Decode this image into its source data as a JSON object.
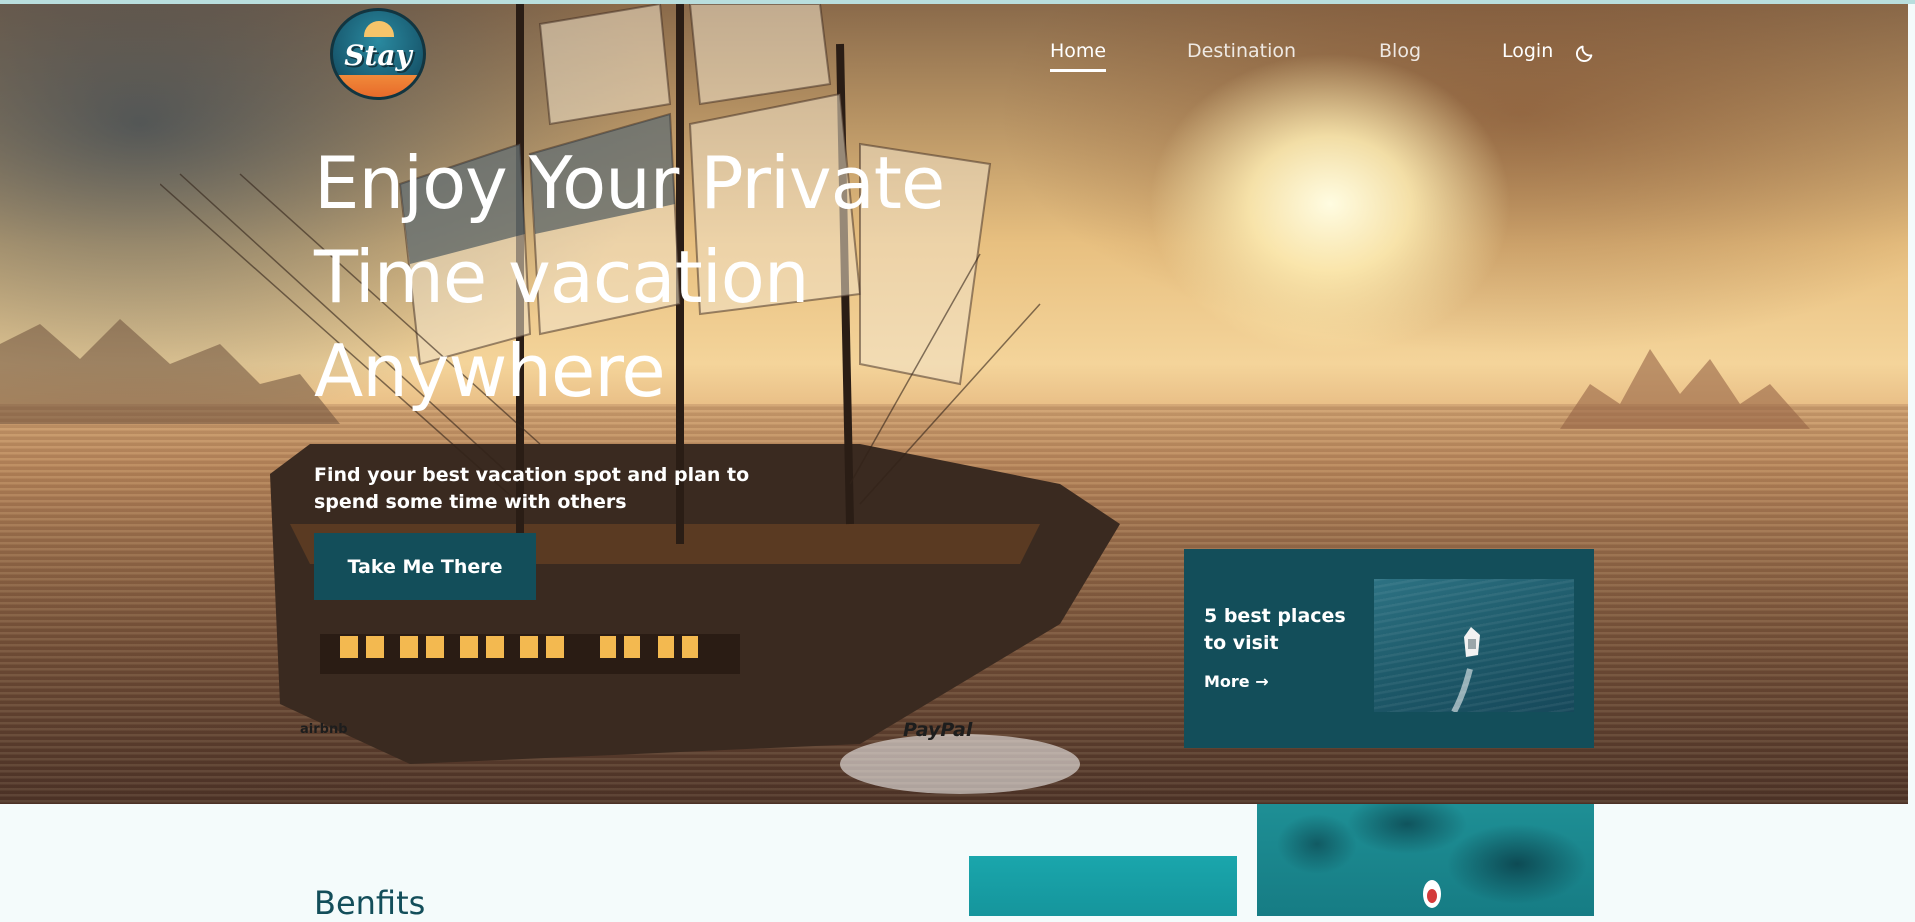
{
  "nav": {
    "logo_text": "Stay",
    "links": [
      {
        "label": "Home",
        "active": true
      },
      {
        "label": "Destination",
        "active": false
      },
      {
        "label": "Blog",
        "active": false
      },
      {
        "label": "Login",
        "active": false
      }
    ],
    "theme_icon": "moon-icon"
  },
  "hero": {
    "title_lines": [
      "Enjoy Your Private",
      "Time vacation",
      "Anywhere"
    ],
    "subtitle": "Find your best vacation spot and plan to spend some time with others",
    "cta_label": "Take Me There",
    "partners": [
      "airbnb",
      "PayPal"
    ]
  },
  "card": {
    "title": "5 best places to visit",
    "more_label": "More",
    "more_icon": "arrow-right-icon"
  },
  "section": {
    "title": "Benfits"
  },
  "colors": {
    "brand": "#134e5a",
    "text_on_dark": "#ffffff",
    "page_bg": "#f4fbfb"
  }
}
